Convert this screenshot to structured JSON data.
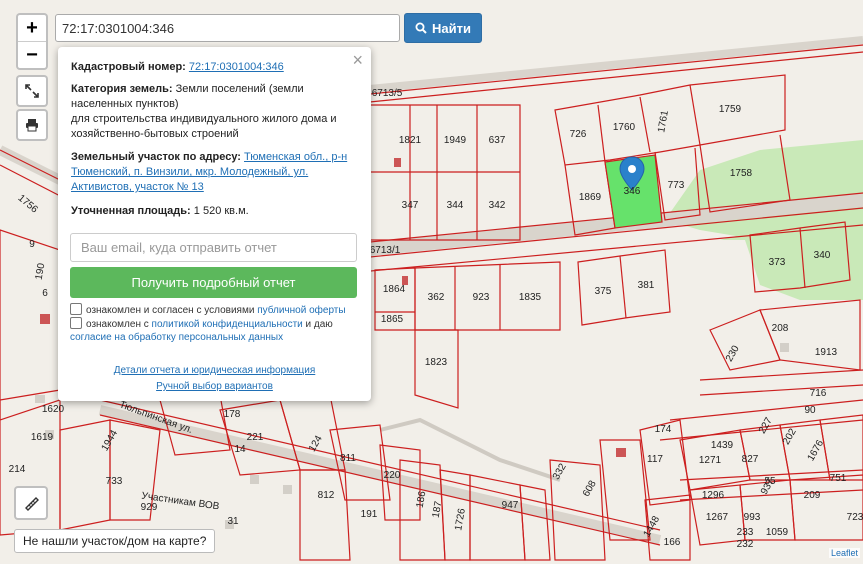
{
  "search": {
    "value": "72:17:0301004:346",
    "button_label": "Найти"
  },
  "zoom": {
    "in_label": "+",
    "out_label": "−"
  },
  "popup": {
    "close_label": "×",
    "cadastral_label": "Кадастровый номер:",
    "cadastral_value": "72:17:0301004:346",
    "category_label": "Категория земель:",
    "category_value": "Земли поселений (земли населенных пунктов)",
    "purpose": "для строительства индивидуального жилого дома и хозяйственно-бытовых строений",
    "address_label": "Земельный участок по адресу:",
    "address_value": "Тюменская обл., р-н Тюменский, п. Винзили, мкр. Молодежный, ул. Активистов, участок № 13",
    "area_label": "Уточненная площадь:",
    "area_value": "1 520 кв.м.",
    "email_placeholder": "Ваш email, куда отправить отчет",
    "report_button": "Получить подробный отчет",
    "consent1_text": "ознакомлен и согласен с условиями",
    "consent1_link": "публичной оферты",
    "consent2_text_a": "ознакомлен с",
    "consent2_link1": "политикой конфиденциальности",
    "consent2_text_b": "и даю",
    "consent2_link2": "согласие на обработку персональных данных",
    "details_link": "Детали отчета и юридическая информация",
    "manual_link": "Ручной выбор вариантов"
  },
  "map": {
    "street_labels": [
      "6713/5",
      "6713/1",
      "Тюльпинская ул.",
      "Участникам ВОВ"
    ],
    "parcels": [
      "1821",
      "1949",
      "637",
      "347",
      "344",
      "342",
      "726",
      "1760",
      "1761",
      "1759",
      "1869",
      "346",
      "773",
      "1758",
      "373",
      "340",
      "1864",
      "362",
      "923",
      "1835",
      "375",
      "381",
      "1865",
      "1823",
      "208",
      "230",
      "1913",
      "178",
      "221",
      "124",
      "811",
      "220",
      "812",
      "191",
      "186",
      "187",
      "1726",
      "947",
      "332",
      "608",
      "174",
      "117",
      "1439",
      "1271",
      "827",
      "1296",
      "1267",
      "993",
      "1059",
      "1448",
      "166",
      "1944",
      "733",
      "929",
      "1620",
      "1619",
      "214",
      "1756",
      "190",
      "9",
      "6",
      "14",
      "31",
      "209",
      "751",
      "716",
      "90",
      "202",
      "1676",
      "227",
      "55",
      "937",
      "233",
      "232",
      "723"
    ]
  },
  "not_found_label": "Не нашли участок/дом на карте?",
  "attribution": "Leaflet",
  "colors": {
    "parcel_line": "#cc1f1f",
    "selected_fill": "#66e26b",
    "green_area": "#c9e9b8",
    "accent": "#337ab7",
    "report_btn": "#5cb85c"
  }
}
